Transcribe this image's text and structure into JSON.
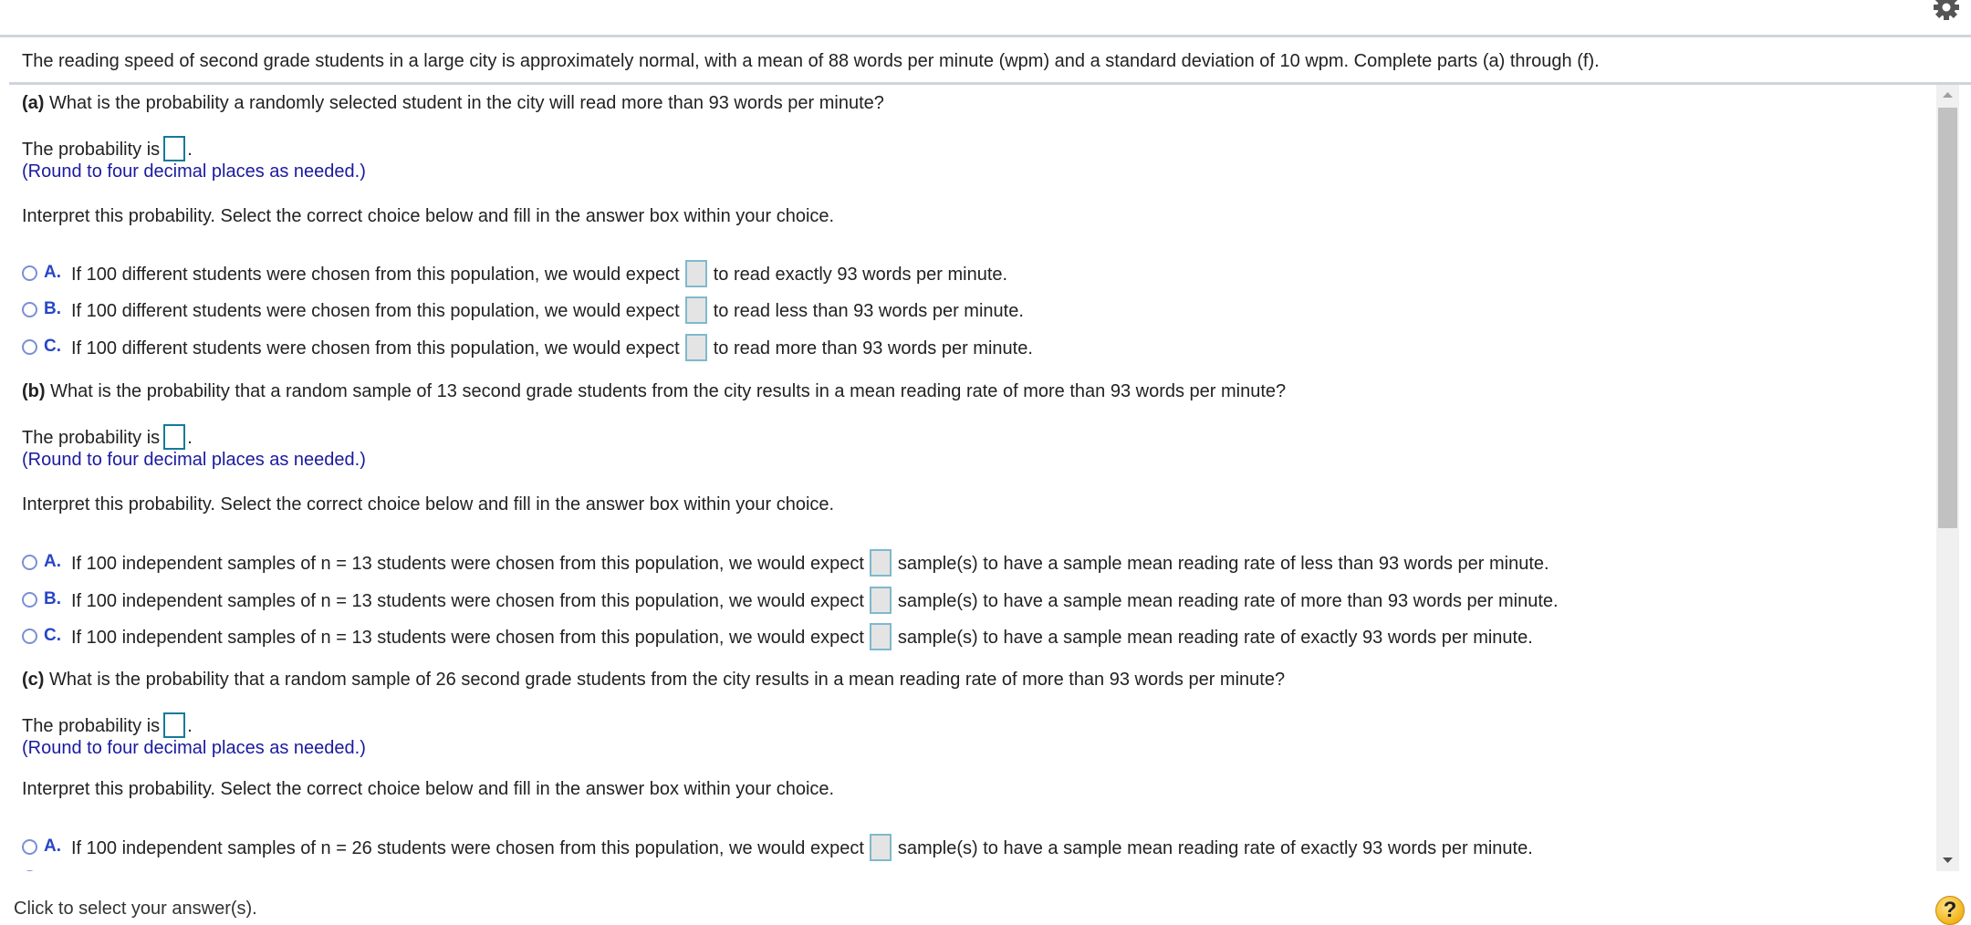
{
  "intro": "The reading speed of second grade students in a large city is approximately normal, with a mean of 88 words per minute (wpm) and a standard deviation of 10 wpm. Complete parts (a) through (f).",
  "icons": {
    "settings": "gear-icon",
    "help": "help-icon",
    "scroll_up": "triangle-up-icon",
    "scroll_down": "triangle-down-icon"
  },
  "colors": {
    "hint": "#1a1aa0",
    "choice_letter": "#2846c6",
    "answer_box_border": "#147a9a",
    "choice_box_border": "#7fb9cc",
    "rule": "#cfd4dc"
  },
  "probability_prefix": "The probability is",
  "probability_suffix": ".",
  "round_hint": "(Round to four decimal places as needed.)",
  "interpret": "Interpret this probability. Select the correct choice below and fill in the answer box within your choice.",
  "parts": [
    {
      "label": "(a)",
      "question": " What is the probability a randomly selected student in the city will read more than 93 words per minute?",
      "answer_value": "",
      "choices": [
        {
          "letter": "A.",
          "pre": "If 100 different students were chosen from this population, we would expect",
          "post": "to read exactly 93 words per minute.",
          "value": ""
        },
        {
          "letter": "B.",
          "pre": "If 100 different students were chosen from this population, we would expect",
          "post": "to read less than 93 words per minute.",
          "value": ""
        },
        {
          "letter": "C.",
          "pre": "If 100 different students were chosen from this population, we would expect",
          "post": "to read more than 93 words per minute.",
          "value": ""
        }
      ]
    },
    {
      "label": "(b)",
      "question": " What is the probability that a random sample of 13 second grade students from the city results in a mean reading rate of more than 93 words per minute?",
      "answer_value": "",
      "choices": [
        {
          "letter": "A.",
          "pre": "If 100 independent samples of n = 13 students were chosen from this population, we would expect",
          "post": "sample(s) to have a sample mean reading rate of less than 93 words per minute.",
          "value": ""
        },
        {
          "letter": "B.",
          "pre": "If 100 independent samples of n = 13 students were chosen from this population, we would expect",
          "post": "sample(s) to have a sample mean reading rate of more than 93 words per minute.",
          "value": ""
        },
        {
          "letter": "C.",
          "pre": "If 100 independent samples of n = 13 students were chosen from this population, we would expect",
          "post": "sample(s) to have a sample mean reading rate of exactly 93 words per minute.",
          "value": ""
        }
      ]
    },
    {
      "label": "(c)",
      "question": " What is the probability that a random sample of 26 second grade students from the city results in a mean reading rate of more than 93 words per minute?",
      "answer_value": "",
      "choices": [
        {
          "letter": "A.",
          "pre": "If 100 independent samples of n = 26 students were chosen from this population, we would expect",
          "post": "sample(s) to have a sample mean reading rate of exactly 93 words per minute.",
          "value": ""
        }
      ]
    }
  ],
  "footer": {
    "status": "Click to select your answer(s).",
    "help_label": "?"
  }
}
